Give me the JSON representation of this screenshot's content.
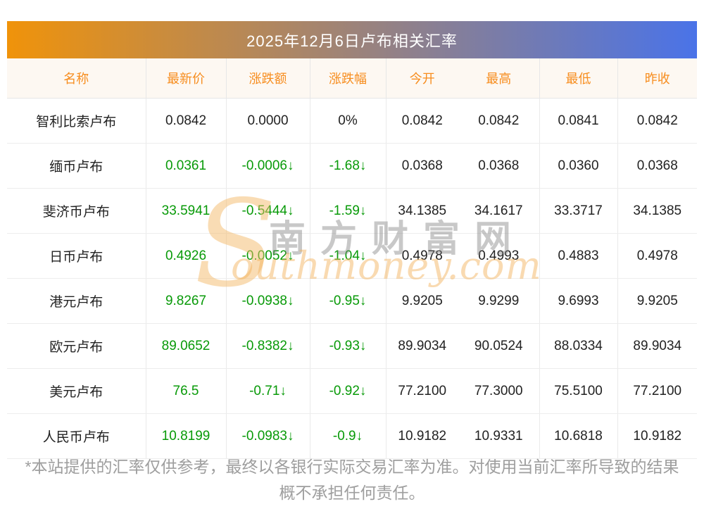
{
  "title_bar": {
    "title": "2025年12月6日卢布相关汇率"
  },
  "table": {
    "columns": [
      {
        "key": "name",
        "label": "名称"
      },
      {
        "key": "latest",
        "label": "最新价"
      },
      {
        "key": "change",
        "label": "涨跌额"
      },
      {
        "key": "change_pct",
        "label": "涨跌幅"
      },
      {
        "key": "open",
        "label": "今开"
      },
      {
        "key": "high",
        "label": "最高"
      },
      {
        "key": "low",
        "label": "最低"
      },
      {
        "key": "prev_close",
        "label": "昨收"
      }
    ],
    "rows": [
      {
        "name": "智利比索卢布",
        "latest": "0.0842",
        "change": "0.0000",
        "change_pct": "0%",
        "open": "0.0842",
        "high": "0.0842",
        "low": "0.0841",
        "prev_close": "0.0842",
        "trend": "flat"
      },
      {
        "name": "缅币卢布",
        "latest": "0.0361",
        "change": "-0.0006↓",
        "change_pct": "-1.68↓",
        "open": "0.0368",
        "high": "0.0368",
        "low": "0.0360",
        "prev_close": "0.0368",
        "trend": "down"
      },
      {
        "name": "斐济币卢布",
        "latest": "33.5941",
        "change": "-0.5444↓",
        "change_pct": "-1.59↓",
        "open": "34.1385",
        "high": "34.1617",
        "low": "33.3717",
        "prev_close": "34.1385",
        "trend": "down"
      },
      {
        "name": "日币卢布",
        "latest": "0.4926",
        "change": "-0.0052↓",
        "change_pct": "-1.04↓",
        "open": "0.4978",
        "high": "0.4993",
        "low": "0.4883",
        "prev_close": "0.4978",
        "trend": "down"
      },
      {
        "name": "港元卢布",
        "latest": "9.8267",
        "change": "-0.0938↓",
        "change_pct": "-0.95↓",
        "open": "9.9205",
        "high": "9.9299",
        "low": "9.6993",
        "prev_close": "9.9205",
        "trend": "down"
      },
      {
        "name": "欧元卢布",
        "latest": "89.0652",
        "change": "-0.8382↓",
        "change_pct": "-0.93↓",
        "open": "89.9034",
        "high": "90.0524",
        "low": "88.0334",
        "prev_close": "89.9034",
        "trend": "down"
      },
      {
        "name": "美元卢布",
        "latest": "76.5",
        "change": "-0.71↓",
        "change_pct": "-0.92↓",
        "open": "77.2100",
        "high": "77.3000",
        "low": "75.5100",
        "prev_close": "77.2100",
        "trend": "down"
      },
      {
        "name": "人民币卢布",
        "latest": "10.8199",
        "change": "-0.0983↓",
        "change_pct": "-0.9↓",
        "open": "10.9182",
        "high": "10.9331",
        "low": "10.6818",
        "prev_close": "10.9182",
        "trend": "down"
      }
    ]
  },
  "watermark": {
    "logo_s": "S",
    "site_name_cn": "南方财富网",
    "site_domain_en": "outhmoney.com"
  },
  "footer": {
    "line1": "*本站提供的汇率仅供参考，最终以各银行实际交易汇率为准。对使用当前汇率所导致的结果",
    "line2": "概不承担任何责任。"
  },
  "colors": {
    "title_gradient_start": "#f0930a",
    "title_gradient_end": "#4a73e8",
    "title_text": "#ffffff",
    "header_bg": "#fdf8f2",
    "header_text": "#f78d1e",
    "value_down_green": "#089a08",
    "value_neutral_black": "#222222",
    "grid_border": "#eaeaea",
    "footer_text": "#9e9e9e",
    "watermark_orange": "#f2b25c",
    "watermark_gray": "#7d7d7d"
  }
}
